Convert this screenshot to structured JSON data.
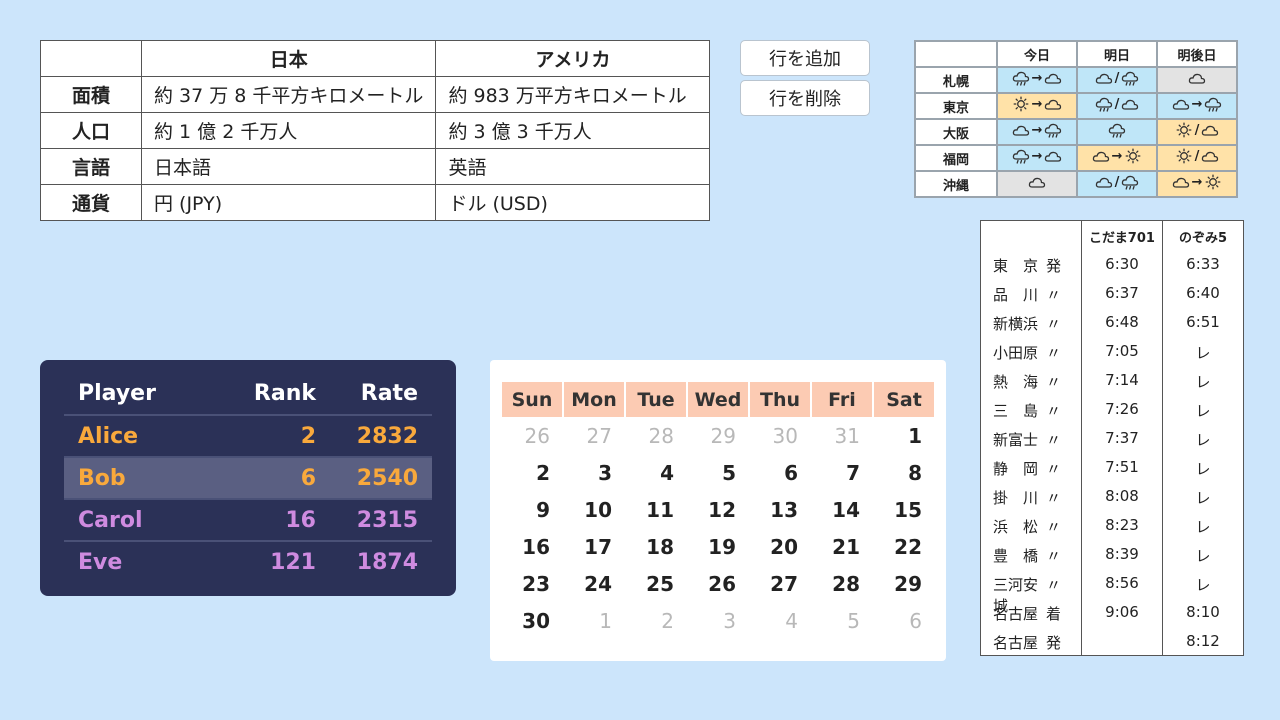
{
  "comparison": {
    "headers": [
      "",
      "日本",
      "アメリカ"
    ],
    "rows": [
      {
        "label": "面積",
        "japan": "約 37 万 8 千平方キロメートル",
        "usa": "約 983 万平方キロメートル"
      },
      {
        "label": "人口",
        "japan": "約 1 億 2 千万人",
        "usa": "約 3 億 3 千万人"
      },
      {
        "label": "言語",
        "japan": "日本語",
        "usa": "英語"
      },
      {
        "label": "通貨",
        "japan": "円 (JPY)",
        "usa": "ドル (USD)"
      }
    ]
  },
  "buttons": {
    "add_row": "行を追加",
    "delete_row": "行を削除"
  },
  "weather": {
    "days": [
      "今日",
      "明日",
      "明後日"
    ],
    "colors": {
      "rain": "#bfe6f8",
      "sun": "#ffe2a8",
      "cloud": "#e3e3e3"
    },
    "rows": [
      {
        "city": "札幌",
        "cells": [
          {
            "icons": [
              "rain",
              "to",
              "cloud"
            ],
            "bg": "rain"
          },
          {
            "icons": [
              "cloud",
              "or",
              "rain"
            ],
            "bg": "rain"
          },
          {
            "icons": [
              "cloud"
            ],
            "bg": "cloud"
          }
        ]
      },
      {
        "city": "東京",
        "cells": [
          {
            "icons": [
              "sun",
              "to",
              "cloud"
            ],
            "bg": "sun"
          },
          {
            "icons": [
              "rain",
              "or",
              "cloud"
            ],
            "bg": "rain"
          },
          {
            "icons": [
              "cloud",
              "to",
              "rain"
            ],
            "bg": "rain"
          }
        ]
      },
      {
        "city": "大阪",
        "cells": [
          {
            "icons": [
              "cloud",
              "to",
              "rain"
            ],
            "bg": "rain"
          },
          {
            "icons": [
              "rain"
            ],
            "bg": "rain"
          },
          {
            "icons": [
              "sun",
              "or",
              "cloud"
            ],
            "bg": "sun"
          }
        ]
      },
      {
        "city": "福岡",
        "cells": [
          {
            "icons": [
              "rain",
              "to",
              "cloud"
            ],
            "bg": "rain"
          },
          {
            "icons": [
              "cloud",
              "to",
              "sun"
            ],
            "bg": "sun"
          },
          {
            "icons": [
              "sun",
              "or",
              "cloud"
            ],
            "bg": "sun"
          }
        ]
      },
      {
        "city": "沖縄",
        "cells": [
          {
            "icons": [
              "cloud"
            ],
            "bg": "cloud"
          },
          {
            "icons": [
              "cloud",
              "or",
              "rain"
            ],
            "bg": "rain"
          },
          {
            "icons": [
              "cloud",
              "to",
              "sun"
            ],
            "bg": "sun"
          }
        ]
      }
    ]
  },
  "timetable": {
    "trains": [
      "こだま701",
      "のぞみ5"
    ],
    "rows": [
      {
        "station": "東　京",
        "mark": "発",
        "t1": "6:30",
        "t2": "6:33"
      },
      {
        "station": "品　川",
        "mark": "〃",
        "t1": "6:37",
        "t2": "6:40"
      },
      {
        "station": "新横浜",
        "mark": "〃",
        "t1": "6:48",
        "t2": "6:51"
      },
      {
        "station": "小田原",
        "mark": "〃",
        "t1": "7:05",
        "t2": "レ"
      },
      {
        "station": "熱　海",
        "mark": "〃",
        "t1": "7:14",
        "t2": "レ"
      },
      {
        "station": "三　島",
        "mark": "〃",
        "t1": "7:26",
        "t2": "レ"
      },
      {
        "station": "新富士",
        "mark": "〃",
        "t1": "7:37",
        "t2": "レ"
      },
      {
        "station": "静　岡",
        "mark": "〃",
        "t1": "7:51",
        "t2": "レ"
      },
      {
        "station": "掛　川",
        "mark": "〃",
        "t1": "8:08",
        "t2": "レ"
      },
      {
        "station": "浜　松",
        "mark": "〃",
        "t1": "8:23",
        "t2": "レ"
      },
      {
        "station": "豊　橋",
        "mark": "〃",
        "t1": "8:39",
        "t2": "レ"
      },
      {
        "station": "三河安城",
        "mark": "〃",
        "t1": "8:56",
        "t2": "レ"
      },
      {
        "station": "名古屋",
        "mark": "着",
        "t1": "9:06",
        "t2": "8:10"
      },
      {
        "station": "名古屋",
        "mark": "発",
        "t1": "",
        "t2": "8:12"
      }
    ]
  },
  "leaderboard": {
    "headers": {
      "player": "Player",
      "rank": "Rank",
      "rate": "Rate"
    },
    "highlight_index": 1,
    "rows": [
      {
        "player": "Alice",
        "rank": "2",
        "rate": "2832",
        "color": "#f9a93c"
      },
      {
        "player": "Bob",
        "rank": "6",
        "rate": "2540",
        "color": "#f9a93c"
      },
      {
        "player": "Carol",
        "rank": "16",
        "rate": "2315",
        "color": "#cf8be0"
      },
      {
        "player": "Eve",
        "rank": "121",
        "rate": "1874",
        "color": "#cf8be0"
      }
    ]
  },
  "calendar": {
    "weekdays": [
      "Sun",
      "Mon",
      "Tue",
      "Wed",
      "Thu",
      "Fri",
      "Sat"
    ],
    "weeks": [
      [
        {
          "d": "26",
          "m": true
        },
        {
          "d": "27",
          "m": true
        },
        {
          "d": "28",
          "m": true
        },
        {
          "d": "29",
          "m": true
        },
        {
          "d": "30",
          "m": true
        },
        {
          "d": "31",
          "m": true
        },
        {
          "d": "1",
          "m": false
        }
      ],
      [
        {
          "d": "2",
          "m": false
        },
        {
          "d": "3",
          "m": false
        },
        {
          "d": "4",
          "m": false
        },
        {
          "d": "5",
          "m": false
        },
        {
          "d": "6",
          "m": false
        },
        {
          "d": "7",
          "m": false
        },
        {
          "d": "8",
          "m": false
        }
      ],
      [
        {
          "d": "9",
          "m": false
        },
        {
          "d": "10",
          "m": false
        },
        {
          "d": "11",
          "m": false
        },
        {
          "d": "12",
          "m": false
        },
        {
          "d": "13",
          "m": false
        },
        {
          "d": "14",
          "m": false
        },
        {
          "d": "15",
          "m": false
        }
      ],
      [
        {
          "d": "16",
          "m": false
        },
        {
          "d": "17",
          "m": false
        },
        {
          "d": "18",
          "m": false
        },
        {
          "d": "19",
          "m": false
        },
        {
          "d": "20",
          "m": false
        },
        {
          "d": "21",
          "m": false
        },
        {
          "d": "22",
          "m": false
        }
      ],
      [
        {
          "d": "23",
          "m": false
        },
        {
          "d": "24",
          "m": false
        },
        {
          "d": "25",
          "m": false
        },
        {
          "d": "26",
          "m": false
        },
        {
          "d": "27",
          "m": false
        },
        {
          "d": "28",
          "m": false
        },
        {
          "d": "29",
          "m": false
        }
      ],
      [
        {
          "d": "30",
          "m": false
        },
        {
          "d": "1",
          "m": true
        },
        {
          "d": "2",
          "m": true
        },
        {
          "d": "3",
          "m": true
        },
        {
          "d": "4",
          "m": true
        },
        {
          "d": "5",
          "m": true
        },
        {
          "d": "6",
          "m": true
        }
      ]
    ]
  }
}
